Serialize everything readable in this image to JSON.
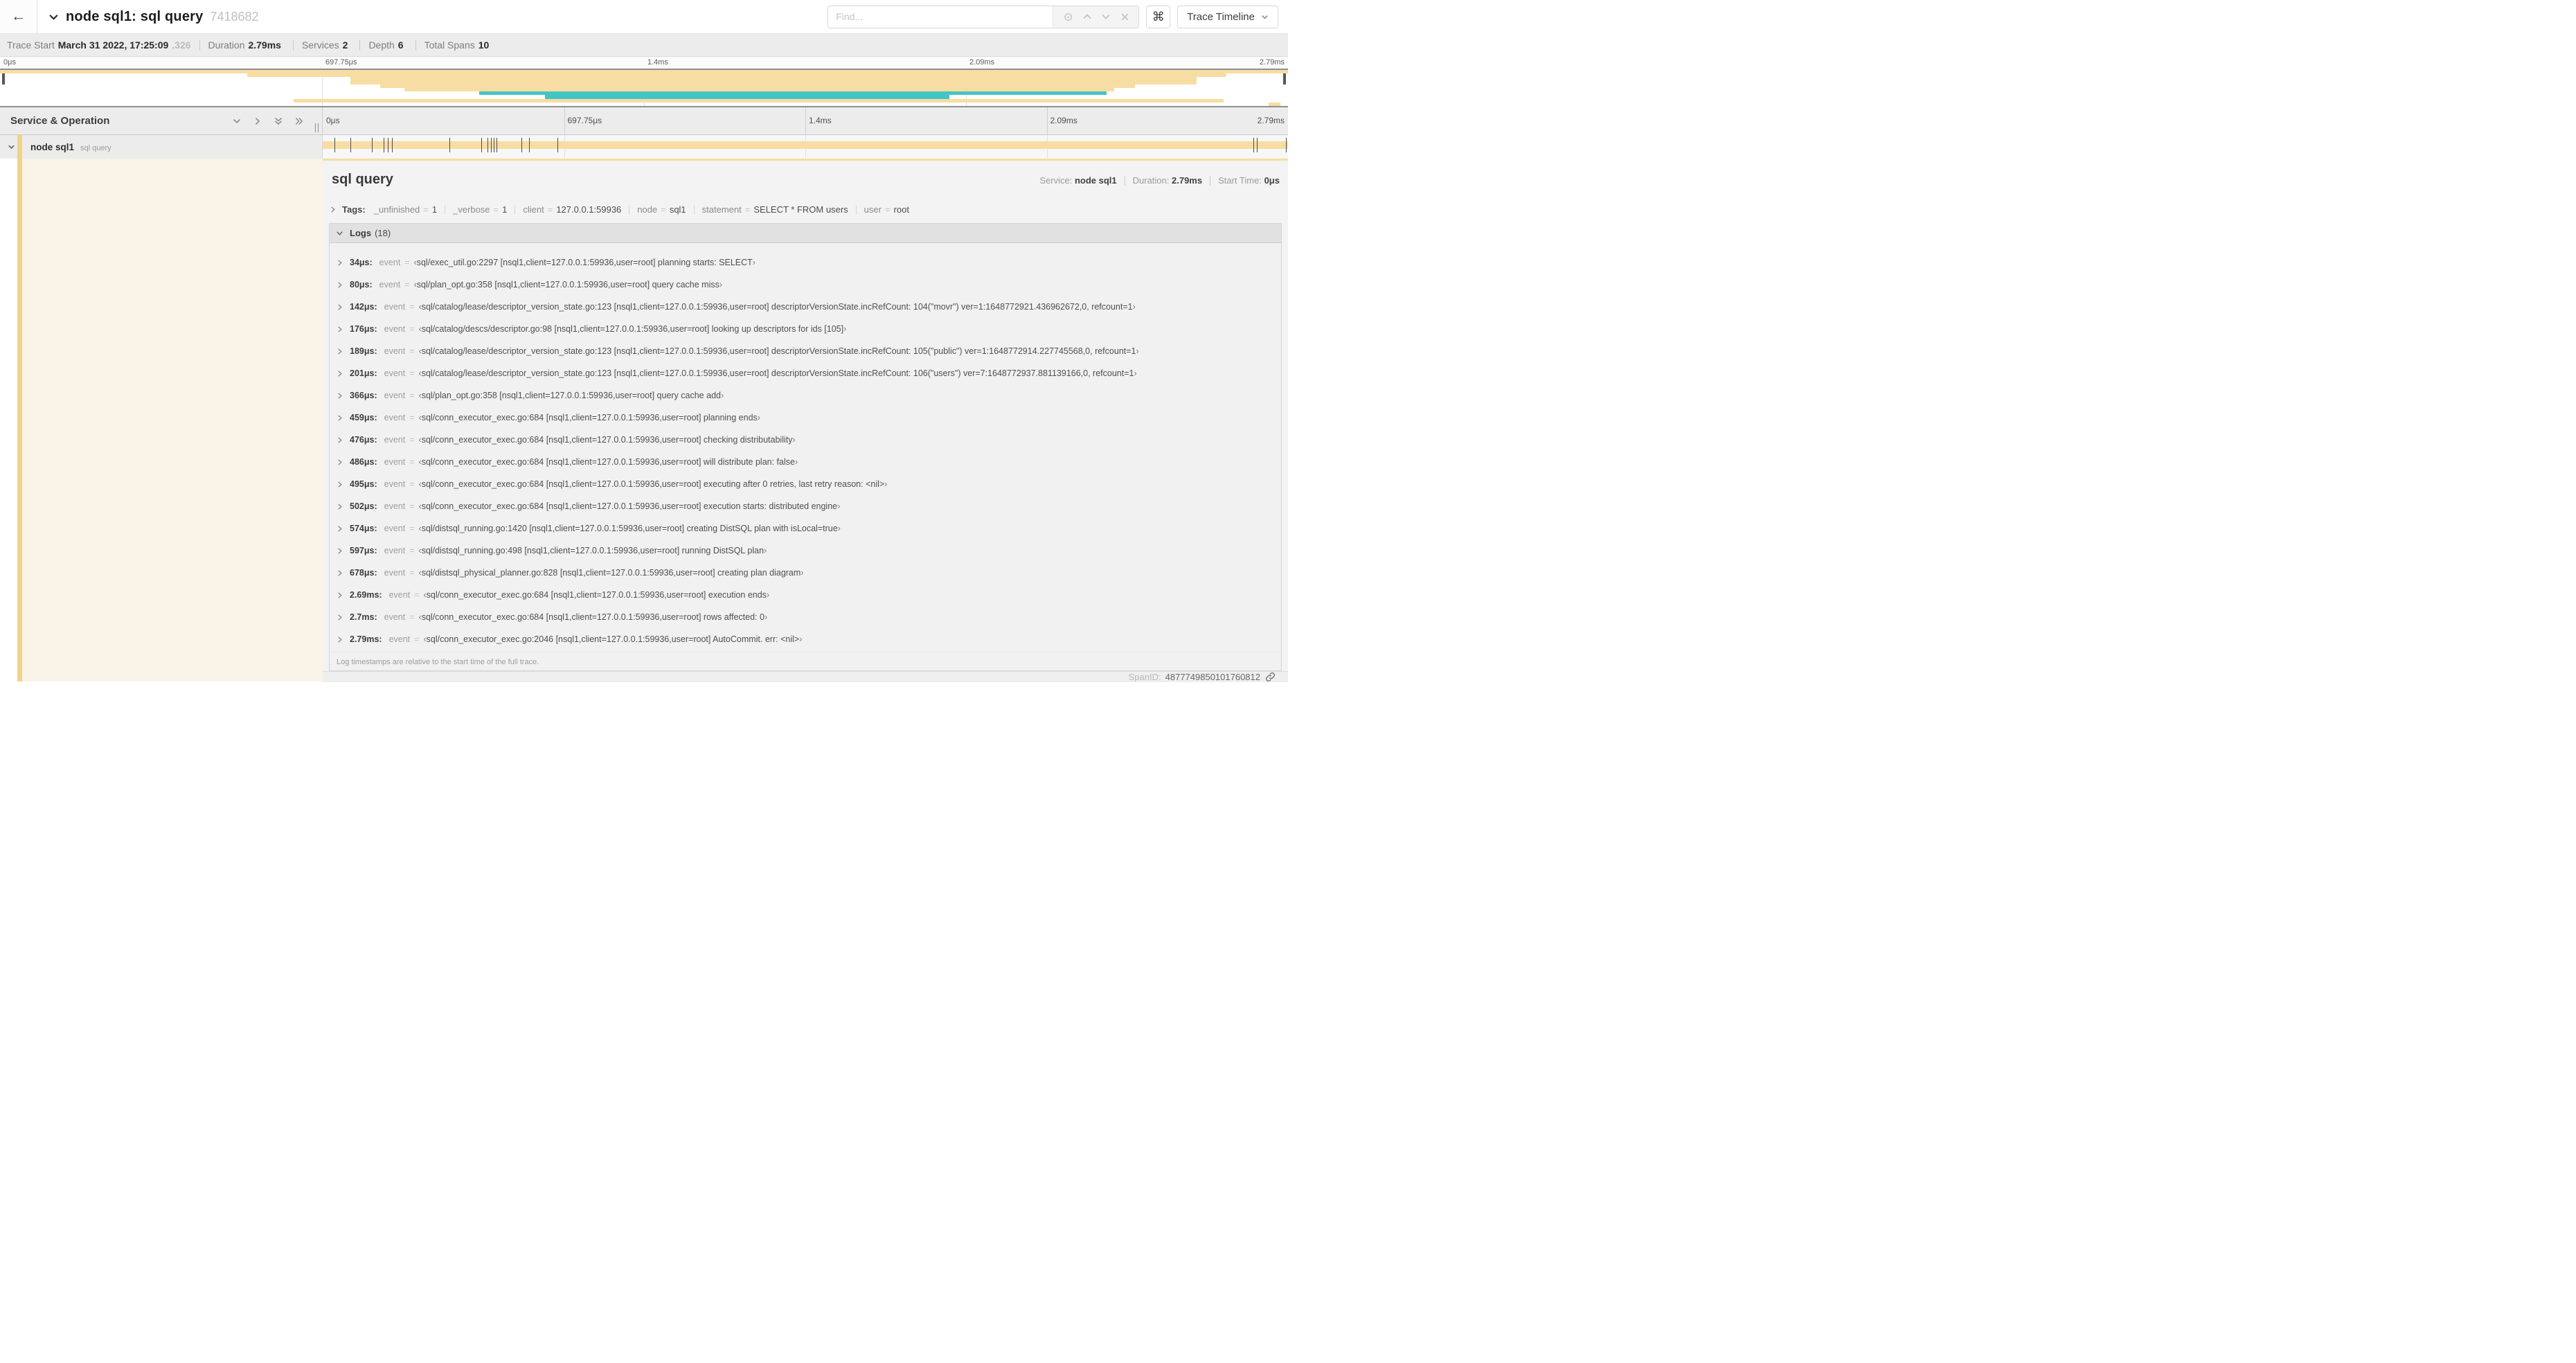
{
  "header": {
    "back_icon": "←",
    "title": "node sql1: sql query",
    "trace_id": "7418682",
    "find_placeholder": "Find...",
    "shortcut_icon": "⌘",
    "view_selector_label": "Trace Timeline"
  },
  "trace_info": {
    "items": [
      {
        "label": "Trace Start",
        "value": "March 31 2022, 17:25:09",
        "suffix": ".326"
      },
      {
        "label": "Duration",
        "value": "2.79ms"
      },
      {
        "label": "Services",
        "value": "2"
      },
      {
        "label": "Depth",
        "value": "6"
      },
      {
        "label": "Total Spans",
        "value": "10"
      }
    ]
  },
  "colors": {
    "span_tan": "#f7dda4",
    "span_teal": "#44c5c5",
    "band_tan": "#f2d385",
    "band_cream": "#faf3e8"
  },
  "minimap": {
    "ticks": [
      {
        "label": "0μs",
        "pos": 0
      },
      {
        "label": "697.75μs",
        "pos": 25
      },
      {
        "label": "1.4ms",
        "pos": 50
      },
      {
        "label": "2.09ms",
        "pos": 75
      },
      {
        "label": "2.79ms",
        "pos": 100
      }
    ],
    "spans": [
      {
        "start": 0,
        "end": 100,
        "color": "span_tan"
      },
      {
        "start": 19.2,
        "end": 95.2,
        "color": "span_tan"
      },
      {
        "start": 27.2,
        "end": 92.9,
        "color": "span_tan"
      },
      {
        "start": 27.2,
        "end": 92.9,
        "color": "span_tan"
      },
      {
        "start": 29.5,
        "end": 88.1,
        "color": "span_tan"
      },
      {
        "start": 31.4,
        "end": 86.5,
        "color": "span_tan"
      },
      {
        "start": 37.2,
        "end": 85.9,
        "color": "span_teal"
      },
      {
        "start": 42.3,
        "end": 73.7,
        "color": "span_teal"
      },
      {
        "start": 22.8,
        "end": 95.0,
        "color": "span_tan"
      },
      {
        "start": 98.5,
        "end": 99.4,
        "color": "span_tan"
      }
    ]
  },
  "timeline": {
    "left_header": "Service & Operation",
    "ticks": [
      {
        "label": "0μs",
        "pos": 0
      },
      {
        "label": "697.75μs",
        "pos": 25
      },
      {
        "label": "1.4ms",
        "pos": 50
      },
      {
        "label": "2.09ms",
        "pos": 75
      },
      {
        "label": "2.79ms",
        "pos": 100
      }
    ],
    "row": {
      "service": "node sql1",
      "operation": "sql query"
    },
    "log_marker_positions_pct": [
      1.22,
      2.87,
      5.09,
      6.31,
      6.77,
      7.2,
      13.12,
      16.45,
      17.06,
      17.42,
      17.74,
      18.0,
      20.57,
      21.4,
      24.3,
      96.42,
      96.77,
      99.8
    ]
  },
  "detail": {
    "title": "sql query",
    "overview": [
      {
        "label": "Service:",
        "value": "node sql1"
      },
      {
        "label": "Duration:",
        "value": "2.79ms"
      },
      {
        "label": "Start Time:",
        "value": "0μs"
      }
    ],
    "tags_label": "Tags:",
    "tags": [
      {
        "key": "_unfinished",
        "value": "1"
      },
      {
        "key": "_verbose",
        "value": "1"
      },
      {
        "key": "client",
        "value": "127.0.0.1:59936"
      },
      {
        "key": "node",
        "value": "sql1"
      },
      {
        "key": "statement",
        "value": "SELECT * FROM users"
      },
      {
        "key": "user",
        "value": "root"
      }
    ],
    "logs_label": "Logs",
    "logs_count": "(18)",
    "log_field_key": "event",
    "open_quote": "‹",
    "close_quote": "›",
    "logs": [
      {
        "time": "34μs:",
        "message": "sql/exec_util.go:2297 [nsql1,client=127.0.0.1:59936,user=root] planning starts: SELECT"
      },
      {
        "time": "80μs:",
        "message": "sql/plan_opt.go:358 [nsql1,client=127.0.0.1:59936,user=root] query cache miss"
      },
      {
        "time": "142μs:",
        "message": "sql/catalog/lease/descriptor_version_state.go:123 [nsql1,client=127.0.0.1:59936,user=root] descriptorVersionState.incRefCount: 104(\"movr\") ver=1:1648772921.436962672,0, refcount=1"
      },
      {
        "time": "176μs:",
        "message": "sql/catalog/descs/descriptor.go:98 [nsql1,client=127.0.0.1:59936,user=root] looking up descriptors for ids [105]"
      },
      {
        "time": "189μs:",
        "message": "sql/catalog/lease/descriptor_version_state.go:123 [nsql1,client=127.0.0.1:59936,user=root] descriptorVersionState.incRefCount: 105(\"public\") ver=1:1648772914.227745568,0, refcount=1"
      },
      {
        "time": "201μs:",
        "message": "sql/catalog/lease/descriptor_version_state.go:123 [nsql1,client=127.0.0.1:59936,user=root] descriptorVersionState.incRefCount: 106(\"users\") ver=7:1648772937.881139166,0, refcount=1"
      },
      {
        "time": "366μs:",
        "message": "sql/plan_opt.go:358 [nsql1,client=127.0.0.1:59936,user=root] query cache add"
      },
      {
        "time": "459μs:",
        "message": "sql/conn_executor_exec.go:684 [nsql1,client=127.0.0.1:59936,user=root] planning ends"
      },
      {
        "time": "476μs:",
        "message": "sql/conn_executor_exec.go:684 [nsql1,client=127.0.0.1:59936,user=root] checking distributability"
      },
      {
        "time": "486μs:",
        "message": "sql/conn_executor_exec.go:684 [nsql1,client=127.0.0.1:59936,user=root] will distribute plan: false"
      },
      {
        "time": "495μs:",
        "message": "sql/conn_executor_exec.go:684 [nsql1,client=127.0.0.1:59936,user=root] executing after 0 retries, last retry reason: <nil>"
      },
      {
        "time": "502μs:",
        "message": "sql/conn_executor_exec.go:684 [nsql1,client=127.0.0.1:59936,user=root] execution starts: distributed engine"
      },
      {
        "time": "574μs:",
        "message": "sql/distsql_running.go:1420 [nsql1,client=127.0.0.1:59936,user=root] creating DistSQL plan with isLocal=true"
      },
      {
        "time": "597μs:",
        "message": "sql/distsql_running.go:498 [nsql1,client=127.0.0.1:59936,user=root] running DistSQL plan"
      },
      {
        "time": "678μs:",
        "message": "sql/distsql_physical_planner.go:828 [nsql1,client=127.0.0.1:59936,user=root] creating plan diagram"
      },
      {
        "time": "2.69ms:",
        "message": "sql/conn_executor_exec.go:684 [nsql1,client=127.0.0.1:59936,user=root] execution ends"
      },
      {
        "time": "2.7ms:",
        "message": "sql/conn_executor_exec.go:684 [nsql1,client=127.0.0.1:59936,user=root] rows affected: 0"
      },
      {
        "time": "2.79ms:",
        "message": "sql/conn_executor_exec.go:2046 [nsql1,client=127.0.0.1:59936,user=root] AutoCommit. err: <nil>"
      }
    ],
    "footer_note": "Log timestamps are relative to the start time of the full trace.",
    "span_id_label": "SpanID:",
    "span_id": "4877749850101760812"
  }
}
